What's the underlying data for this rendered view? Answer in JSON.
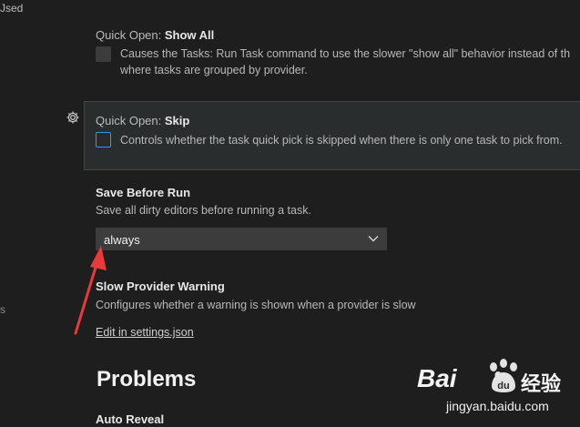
{
  "sidebar": {
    "partial_item": "Jsed",
    "partial_item_2": "s"
  },
  "settings": {
    "show_all": {
      "category": "Quick Open: ",
      "name": "Show All",
      "description_line1": "Causes the Tasks: Run Task command to use the slower \"show all\" behavior instead of th",
      "description_line2": "where tasks are grouped by provider.",
      "checked": false
    },
    "skip": {
      "category": "Quick Open: ",
      "name": "Skip",
      "description": "Controls whether the task quick pick is skipped when there is only one task to pick from.",
      "checked": false,
      "focused": true
    },
    "save_before_run": {
      "title": "Save Before Run",
      "description": "Save all dirty editors before running a task.",
      "selected_value": "always"
    },
    "slow_provider_warning": {
      "title": "Slow Provider Warning",
      "description": "Configures whether a warning is shown when a provider is slow",
      "link": "Edit in settings.json"
    },
    "problems": {
      "heading": "Problems",
      "next_title": "Auto Reveal"
    }
  },
  "watermark": {
    "brand_left": "Bai",
    "brand_right": "经验",
    "url": "jingyan.baidu.com"
  },
  "colors": {
    "background": "#1e1e1e",
    "focus_panel": "#2a2d2e",
    "checkbox_focus_border": "#3794ff",
    "annotation_arrow": "#e83a3a"
  },
  "icons": [
    "gear-icon",
    "chevron-down-icon",
    "annotation-arrow"
  ]
}
